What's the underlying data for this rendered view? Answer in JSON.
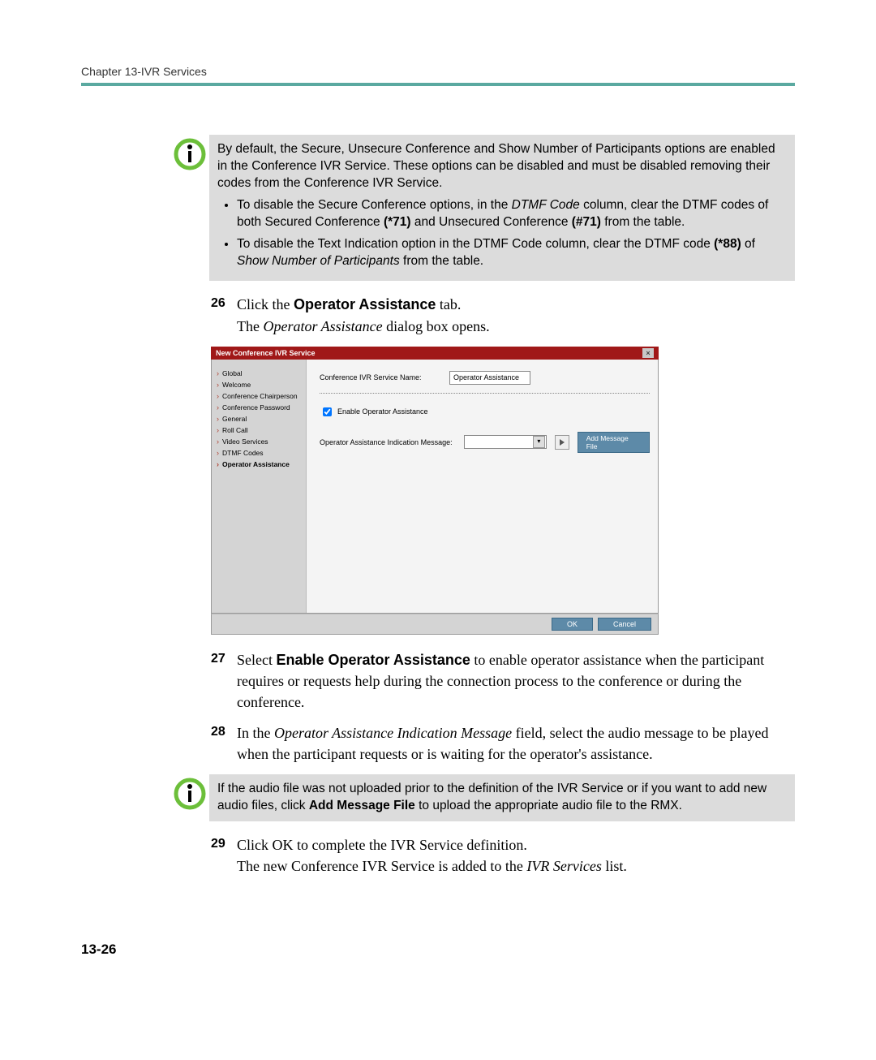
{
  "header": {
    "chapter": "Chapter 13-IVR Services"
  },
  "note1": {
    "intro": "By default, the Secure, Unsecure Conference and Show Number of Participants options are enabled in the Conference IVR Service. These options can be disabled and must be disabled removing their codes from the Conference IVR Service.",
    "bullets": [
      {
        "pre": "To disable the Secure Conference options, in the ",
        "i1": "DTMF Code",
        "mid": " column, clear the DTMF codes of both Secured Conference ",
        "b1": "(*71)",
        "mid2": " and Unsecured Conference ",
        "b2": "(#71)",
        "post": " from the table."
      },
      {
        "pre": "To disable the Text Indication option in the DTMF Code column, clear the DTMF code ",
        "b1": "(*88)",
        "mid": " of ",
        "i1": "Show Number of Participants",
        "post": " from the table."
      }
    ]
  },
  "steps": {
    "s26": {
      "num": "26",
      "l1a": "Click the ",
      "l1b": "Operator Assistance",
      "l1c": " tab.",
      "l2a": "The ",
      "l2b": "Operator Assistance",
      "l2c": " dialog box opens."
    },
    "s27": {
      "num": "27",
      "a": "Select ",
      "b": "Enable Operator Assistance",
      "c": " to enable operator assistance when the participant requires or requests help during the connection process to the conference or during the conference."
    },
    "s28": {
      "num": "28",
      "a": "In the ",
      "b": "Operator Assistance Indication Message",
      "c": " field, select the audio message to be played when the participant requests or is waiting for the operator's assistance."
    },
    "s29": {
      "num": "29",
      "l1": "Click OK to complete the IVR Service definition.",
      "l2a": "The new Conference IVR Service is added to the ",
      "l2b": "IVR Services",
      "l2c": " list."
    }
  },
  "note2": {
    "a": "If the audio file was not uploaded prior to the definition of the IVR Service or if you want to add new audio files, click ",
    "b": "Add Message File",
    "c": " to upload the appropriate audio file to the RMX."
  },
  "dialog": {
    "title": "New Conference IVR Service",
    "side": [
      "Global",
      "Welcome",
      "Conference Chairperson",
      "Conference Password",
      "General",
      "Roll Call",
      "Video Services",
      "DTMF Codes",
      "Operator Assistance"
    ],
    "fld_service_name_label": "Conference IVR Service Name:",
    "fld_service_name_value": "Operator Assistance",
    "chk_label": "Enable Operator Assistance",
    "fld_msg_label": "Operator Assistance Indication Message:",
    "btn_add_file": "Add Message File",
    "btn_ok": "OK",
    "btn_cancel": "Cancel"
  },
  "page_number": "13-26"
}
